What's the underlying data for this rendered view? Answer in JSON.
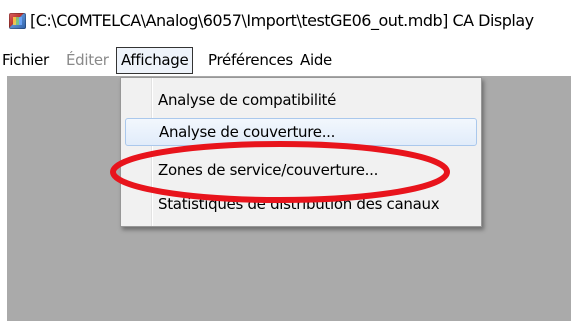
{
  "window": {
    "title": "[C:\\COMTELCA\\Analog\\6057\\Import\\testGE06_out.mdb] CA Display",
    "icon": "app-icon"
  },
  "menubar": {
    "items": [
      {
        "label": "Fichier",
        "enabled": true
      },
      {
        "label": "Éditer",
        "enabled": false
      },
      {
        "label": "Affichage",
        "enabled": true,
        "open": true
      },
      {
        "label": "Préférences",
        "enabled": true
      },
      {
        "label": "Aide",
        "enabled": true
      }
    ]
  },
  "affichage_menu": {
    "items": [
      {
        "label": "Analyse de compatibilité"
      },
      {
        "label": "Analyse de couverture..."
      },
      {
        "label": "Zones de service/couverture..."
      },
      {
        "label": "Statistiques de distribution des canaux"
      }
    ],
    "hovered_index": 1
  },
  "annotation": {
    "shape": "ellipse",
    "color": "#e8141c",
    "target": "Zones de service/couverture..."
  },
  "colors": {
    "client_area": "#aaaaaa",
    "menu_background": "#f1f1f1",
    "hover_border": "#aac8ec"
  }
}
